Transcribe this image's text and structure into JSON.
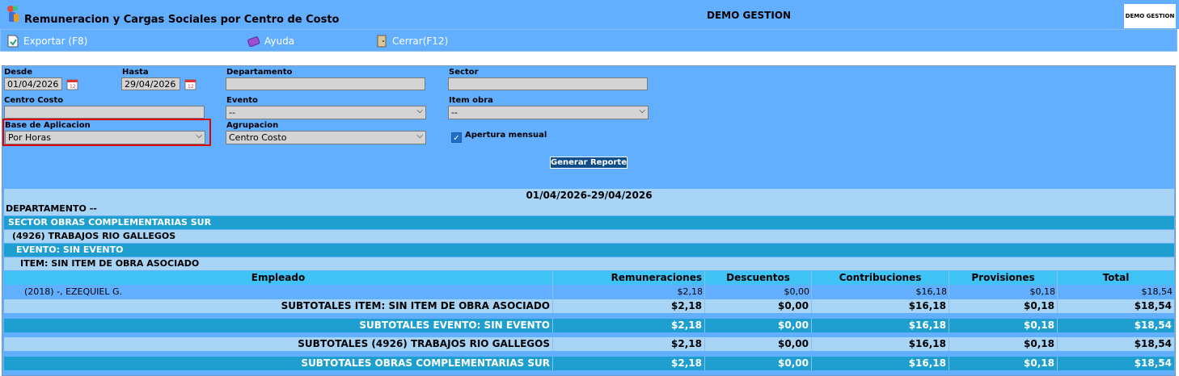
{
  "header": {
    "title": "Remuneracion y Cargas Sociales por Centro de Costo",
    "company": "DEMO GESTION",
    "brand_logo_text": "DEMO GESTION"
  },
  "toolbar": {
    "export_label": "Exportar (F8)",
    "help_label": "Ayuda",
    "close_label": "Cerrar(F12)"
  },
  "filters": {
    "desde_label": "Desde",
    "desde_value": "01/04/2026",
    "hasta_label": "Hasta",
    "hasta_value": "29/04/2026",
    "departamento_label": "Departamento",
    "departamento_value": "",
    "sector_label": "Sector",
    "sector_value": "",
    "centro_costo_label": "Centro Costo",
    "centro_costo_value": "",
    "evento_label": "Evento",
    "evento_value": "--",
    "item_obra_label": "Item obra",
    "item_obra_value": "--",
    "base_label": "Base de Aplicacion",
    "base_value": "Por Horas",
    "agrupacion_label": "Agrupacion",
    "agrupacion_value": "Centro Costo",
    "apertura_label": "Apertura mensual",
    "apertura_checked": true,
    "generate_label": "Generar Reporte"
  },
  "report": {
    "period": "01/04/2026-29/04/2026",
    "departamento": "DEPARTAMENTO --",
    "sector": "SECTOR OBRAS COMPLEMENTARIAS SUR",
    "centro_costo": "(4926) TRABAJOS RIO GALLEGOS",
    "evento": "EVENTO: SIN EVENTO",
    "item": "ITEM: SIN ITEM DE OBRA ASOCIADO",
    "columns": [
      "Empleado",
      "Remuneraciones",
      "Descuentos",
      "Contribuciones",
      "Provisiones",
      "Total"
    ],
    "employee": {
      "name": "(2018) -, EZEQUIEL G.",
      "remuneraciones": "$2,18",
      "descuentos": "$0,00",
      "contribuciones": "$16,18",
      "provisiones": "$0,18",
      "total": "$18,54"
    },
    "subtotals": [
      {
        "label": "SUBTOTALES ITEM: SIN ITEM DE OBRA ASOCIADO",
        "remuneraciones": "$2,18",
        "descuentos": "$0,00",
        "contribuciones": "$16,18",
        "provisiones": "$0,18",
        "total": "$18,54"
      },
      {
        "label": "SUBTOTALES EVENTO: SIN EVENTO",
        "remuneraciones": "$2,18",
        "descuentos": "$0,00",
        "contribuciones": "$16,18",
        "provisiones": "$0,18",
        "total": "$18,54"
      },
      {
        "label": "SUBTOTALES (4926) TRABAJOS RIO GALLEGOS",
        "remuneraciones": "$2,18",
        "descuentos": "$0,00",
        "contribuciones": "$16,18",
        "provisiones": "$0,18",
        "total": "$18,54"
      },
      {
        "label": "SUBTOTALES OBRAS COMPLEMENTARIAS SUR",
        "remuneraciones": "$2,18",
        "descuentos": "$0,00",
        "contribuciones": "$16,18",
        "provisiones": "$0,18",
        "total": "$18,54"
      }
    ]
  }
}
